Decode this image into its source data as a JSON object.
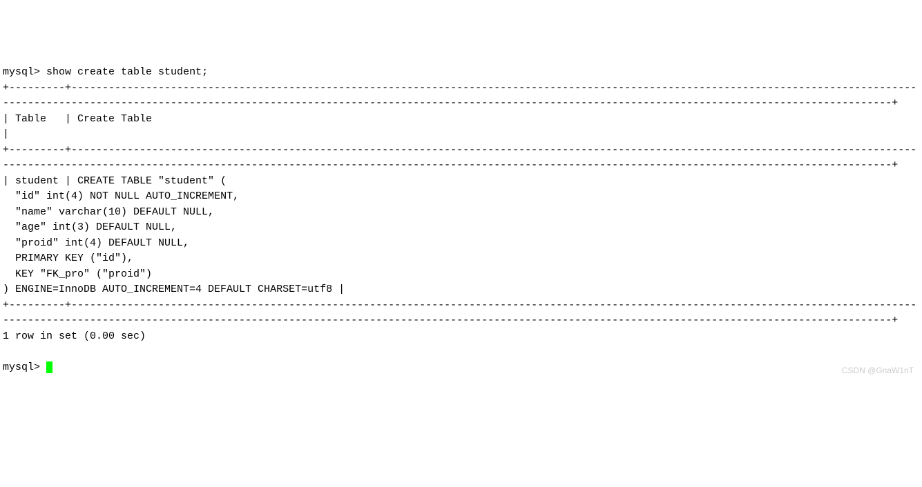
{
  "terminal": {
    "prompt": "mysql>",
    "command": "show create table student;",
    "border_top": "+---------+---------------------------------------------------------------------------------------------------------------------------------------------------------------------------------------------------------------------------------------------------------------------------------------+",
    "header_row": "| Table   | Create Table                                                                                                                                                                                                                                                                            |",
    "border_mid": "+---------+---------------------------------------------------------------------------------------------------------------------------------------------------------------------------------------------------------------------------------------------------------------------------------------+",
    "data_lines": [
      "| student | CREATE TABLE \"student\" (",
      "  \"id\" int(4) NOT NULL AUTO_INCREMENT,",
      "  \"name\" varchar(10) DEFAULT NULL,",
      "  \"age\" int(3) DEFAULT NULL,",
      "  \"proid\" int(4) DEFAULT NULL,",
      "  PRIMARY KEY (\"id\"),",
      "  KEY \"FK_pro\" (\"proid\")",
      ") ENGINE=InnoDB AUTO_INCREMENT=4 DEFAULT CHARSET=utf8 |"
    ],
    "border_bottom": "+---------+---------------------------------------------------------------------------------------------------------------------------------------------------------------------------------------------------------------------------------------------------------------------------------------+",
    "result_summary": "1 row in set (0.00 sec)",
    "prompt_end": "mysql> "
  },
  "watermark": "CSDN @GnaW1nT"
}
